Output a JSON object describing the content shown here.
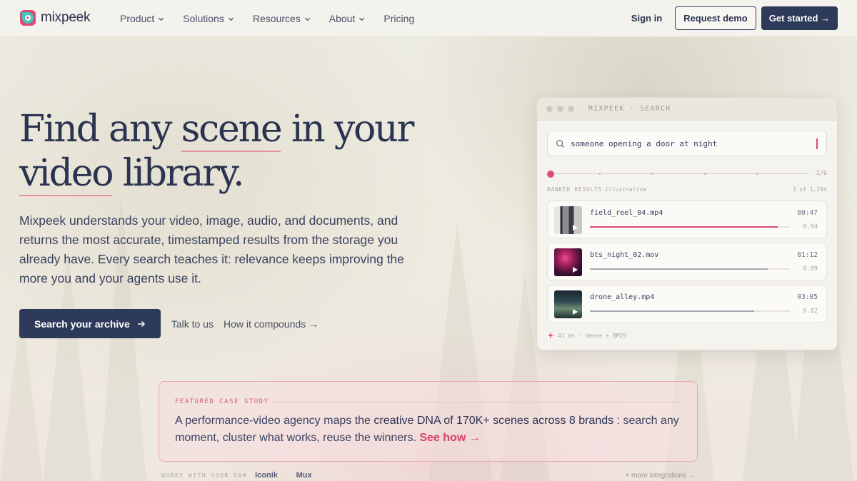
{
  "nav": {
    "logo_text": "mixpeek",
    "menu": [
      {
        "label": "Product",
        "dropdown": true
      },
      {
        "label": "Solutions",
        "dropdown": true
      },
      {
        "label": "Resources",
        "dropdown": true
      },
      {
        "label": "About",
        "dropdown": true
      },
      {
        "label": "Pricing",
        "dropdown": false
      }
    ],
    "sign_in": "Sign in",
    "request_demo": "Request demo",
    "get_started": "Get started →"
  },
  "hero": {
    "title_parts": [
      "Find any ",
      "scene",
      " in your ",
      "video",
      " library."
    ],
    "description": "Mixpeek understands your video, image, audio, and documents, and returns the most accurate, timestamped results from the storage you already have. Every search teaches it: relevance keeps improving the more you and your agents use it.",
    "primary_cta": "Search your archive",
    "talk_link": "Talk to us",
    "compounds_link": "How it compounds →"
  },
  "search_panel": {
    "window_title": "MIXPEEK · SEARCH",
    "query": "someone opening a door at night",
    "step_counter": "1/6",
    "results_label": "RANKED RESULTS",
    "results_note": "illustrative",
    "results_count": "3 of 1,204",
    "results": [
      {
        "file": "field_reel_04.mp4",
        "time": "00:47",
        "score": "0.94",
        "relevance": 0.94,
        "highlight": true
      },
      {
        "file": "bts_night_02.mov",
        "time": "01:12",
        "score": "0.89",
        "relevance": 0.89,
        "highlight": false
      },
      {
        "file": "drone_alley.mp4",
        "time": "03:05",
        "score": "0.82",
        "relevance": 0.82,
        "highlight": false
      }
    ],
    "footer": "41 ms · dense + BM25"
  },
  "case_study": {
    "label": "FEATURED CASE STUDY",
    "text_start": "A performance-video agency maps the ",
    "text_bold": "creative DNA of 170K+ scenes across 8 brands",
    "text_end": " : search any moment, cluster what works, reuse the winners. ",
    "link": "See how →"
  },
  "integrations": {
    "label": "WORKS WITH YOUR DAM",
    "items": [
      "Iconik",
      "Mux"
    ],
    "separator": "·",
    "more": "+ more integrations →"
  },
  "colors": {
    "navy": "#2e3a5a",
    "accent_pink": "#e14876",
    "background": "#ecebe2"
  }
}
